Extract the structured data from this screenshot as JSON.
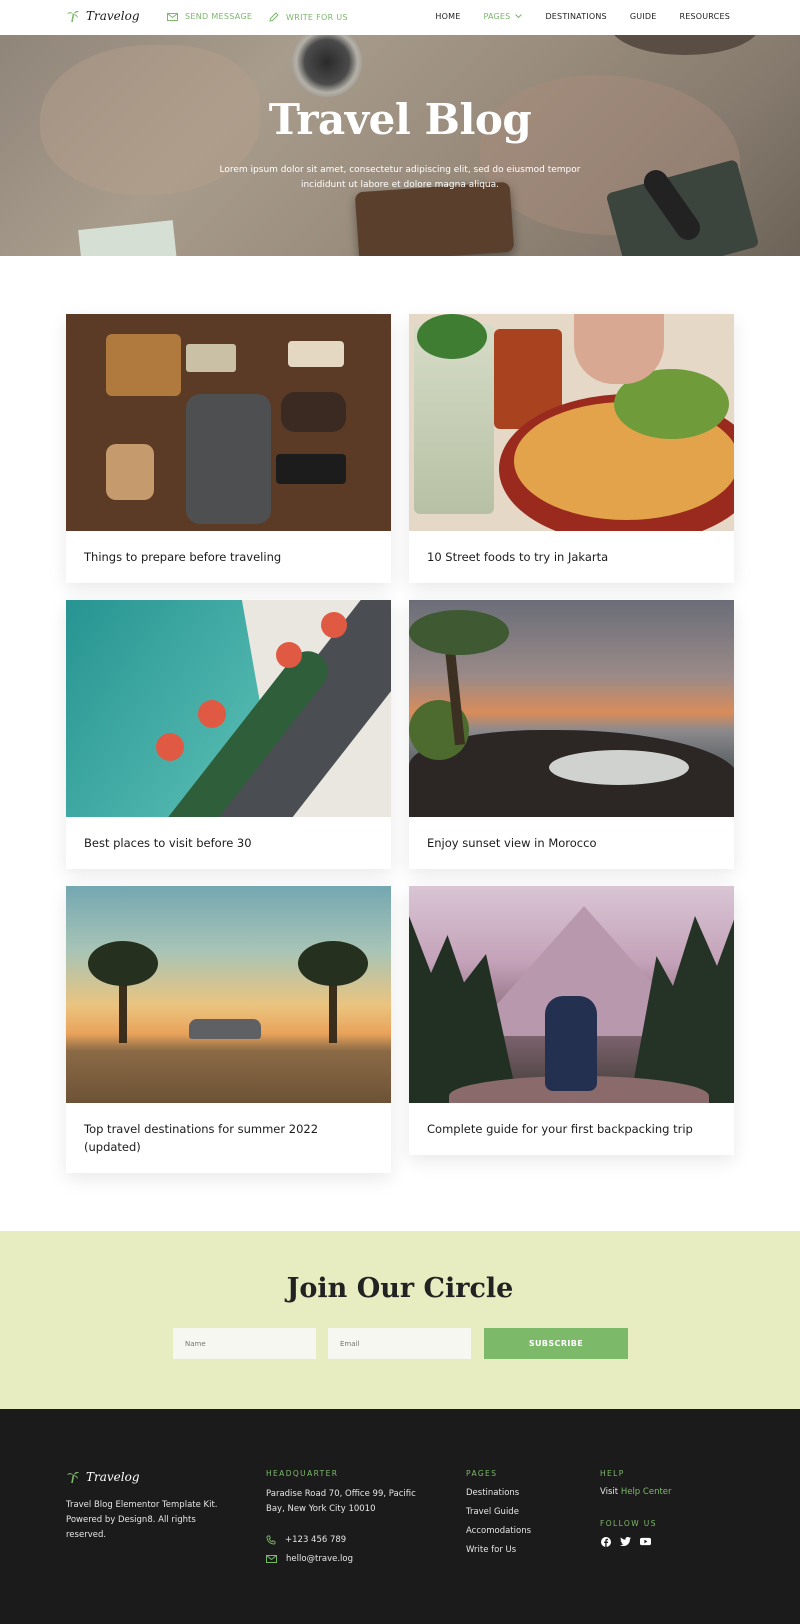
{
  "nav": {
    "brand": "Travelog",
    "quick_links": [
      {
        "label": "SEND MESSAGE",
        "icon": "envelope-icon"
      },
      {
        "label": "WRITE FOR US",
        "icon": "pencil-icon"
      }
    ],
    "menu": [
      {
        "label": "HOME"
      },
      {
        "label": "PAGES",
        "active": true
      },
      {
        "label": "DESTINATIONS"
      },
      {
        "label": "GUIDE"
      },
      {
        "label": "RESOURCES"
      }
    ]
  },
  "hero": {
    "title": "Travel Blog",
    "subtitle": "Lorem ipsum dolor sit amet, consectetur adipiscing elit, sed do eiusmod tempor incididunt ut labore et dolore magna aliqua."
  },
  "posts": [
    {
      "title": "Things to prepare before traveling"
    },
    {
      "title": "10 Street foods to try in Jakarta"
    },
    {
      "title": "Best places to visit before 30"
    },
    {
      "title": "Enjoy sunset view in Morocco"
    },
    {
      "title": "Top travel destinations for summer 2022 (updated)"
    },
    {
      "title": "Complete guide for your first backpacking trip"
    }
  ],
  "newsletter": {
    "title": "Join Our Circle",
    "name_placeholder": "Name",
    "email_placeholder": "Email",
    "button": "SUBSCRIBE"
  },
  "footer": {
    "brand": "Travelog",
    "description": "Travel Blog Elementor Template Kit. Powered by Design8. All rights reserved.",
    "hq_heading": "HEADQUARTER",
    "address": "Paradise Road 70, Office 99, Pacific Bay,  New York City 10010",
    "phone": "+123 456 789",
    "email": "hello@trave.log",
    "pages_heading": "PAGES",
    "pages": [
      "Destinations",
      "Travel Guide",
      "Accomodations",
      "Write for Us"
    ],
    "help_heading": "HELP",
    "help_prefix": "Visit",
    "help_link": "Help Center",
    "follow_heading": "FOLLOW US",
    "social": [
      "facebook-icon",
      "twitter-icon",
      "youtube-icon"
    ]
  },
  "colors": {
    "accent": "#7cba6a",
    "newsletter_bg": "#e7edc0",
    "footer_bg": "#1b1b1b"
  }
}
